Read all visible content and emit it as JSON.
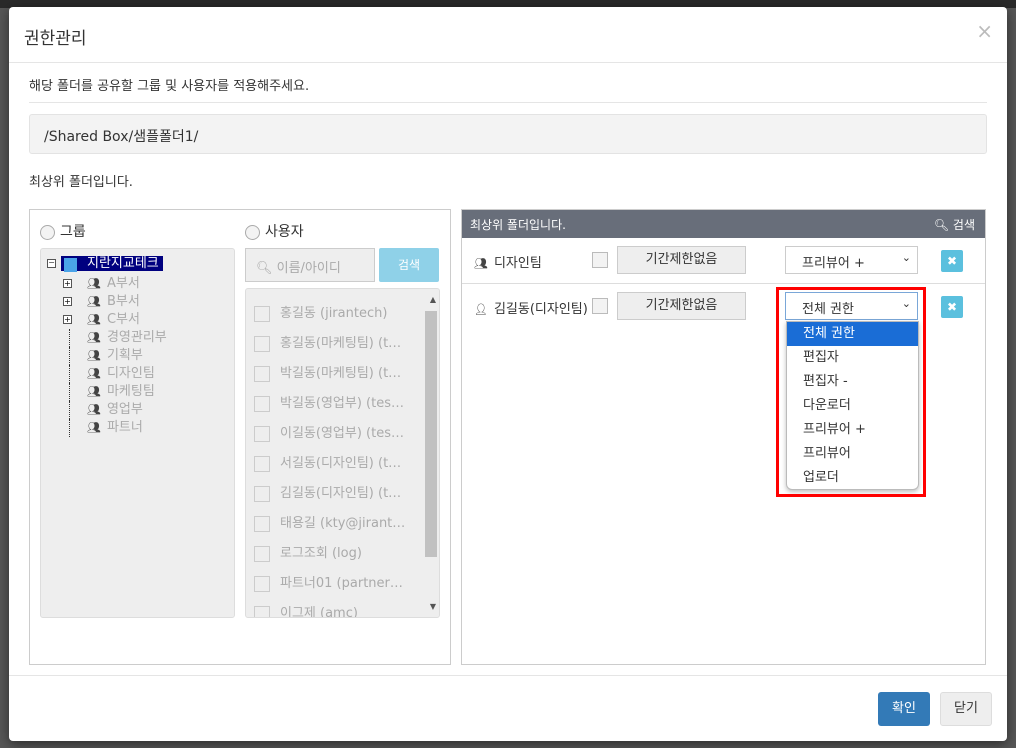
{
  "modal": {
    "title": "권한관리",
    "description": "해당 폴더를 공유할 그룹 및 사용자를 적용해주세요.",
    "path": "/Shared Box/샘플폴더1/",
    "note": "최상위 폴더입니다.",
    "confirm": "확인",
    "close": "닫기"
  },
  "left": {
    "group_label": "그룹",
    "user_label": "사용자",
    "tree_root": "지란지교테크",
    "tree": [
      {
        "label": "A부서",
        "expandable": true
      },
      {
        "label": "B부서",
        "expandable": true
      },
      {
        "label": "C부서",
        "expandable": true
      },
      {
        "label": "경영관리부"
      },
      {
        "label": "기획부"
      },
      {
        "label": "디자인팀"
      },
      {
        "label": "마케팅팀"
      },
      {
        "label": "영업부"
      },
      {
        "label": "파트너"
      }
    ],
    "search_placeholder": "이름/아이디",
    "search_button": "검색",
    "users": [
      "홍길동 (jirantech)",
      "홍길동(마케팅팀) (t…",
      "박길동(마케팅팀) (t…",
      "박길동(영업부) (tes…",
      "이길동(영업부) (tes…",
      "서길동(디자인팀) (t…",
      "김길동(디자인팀) (t…",
      "태용길 (kty@jirant…",
      "로그조회 (log)",
      "파트너01 (partner…",
      "이그제 (amc)"
    ]
  },
  "right": {
    "header": "최상위 폴더입니다.",
    "search": "검색",
    "rows": [
      {
        "type": "group",
        "name": "디자인팀",
        "period": "기간제한없음",
        "permission": "프리뷰어 +"
      },
      {
        "type": "user",
        "name": "김길동(디자인팀)",
        "period": "기간제한없음",
        "permission": "전체 권한"
      }
    ],
    "dropdown_options": [
      "전체 권한",
      "편집자",
      "편집자 -",
      "다운로더",
      "프리뷰어 +",
      "프리뷰어",
      "업로더"
    ],
    "dropdown_selected": "전체 권한"
  },
  "colors": {
    "primary": "#337ab7",
    "header": "#686e7a",
    "highlight": "#1a6dd6",
    "annotation": "#ff0000"
  }
}
